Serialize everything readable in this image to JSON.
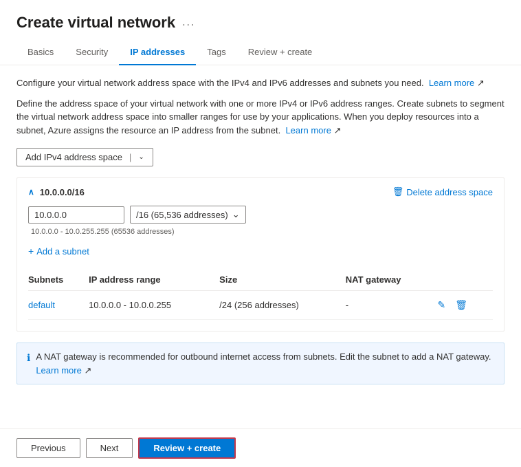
{
  "page": {
    "title": "Create virtual network",
    "more_label": "..."
  },
  "tabs": [
    {
      "id": "basics",
      "label": "Basics",
      "active": false
    },
    {
      "id": "security",
      "label": "Security",
      "active": false
    },
    {
      "id": "ip_addresses",
      "label": "IP addresses",
      "active": true
    },
    {
      "id": "tags",
      "label": "Tags",
      "active": false
    },
    {
      "id": "review_create",
      "label": "Review + create",
      "active": false
    }
  ],
  "descriptions": {
    "line1_text": "Configure your virtual network address space with the IPv4 and IPv6 addresses and subnets you need. ",
    "line1_link": "Learn more",
    "line2_text": "Define the address space of your virtual network with one or more IPv4 or IPv6 address ranges. Create subnets to segment the virtual network address space into smaller ranges for use by your applications. When you deploy resources into a subnet, Azure assigns the resource an IP address from the subnet. ",
    "line2_link": "Learn more"
  },
  "add_address_button": "Add IPv4 address space",
  "address_space": {
    "cidr": "10.0.0.0/16",
    "ip_value": "10.0.0.0",
    "cidr_dropdown": "/16 (65,536 addresses)",
    "hint": "10.0.0.0 - 10.0.255.255 (65536 addresses)",
    "delete_label": "Delete address space",
    "add_subnet_label": "Add a subnet"
  },
  "subnets_table": {
    "headers": [
      "Subnets",
      "IP address range",
      "Size",
      "NAT gateway"
    ],
    "rows": [
      {
        "name": "default",
        "ip_range": "10.0.0.0 - 10.0.0.255",
        "size": "/24 (256 addresses)",
        "nat_gateway": "-"
      }
    ]
  },
  "info_banner": {
    "text": "A NAT gateway is recommended for outbound internet access from subnets. Edit the subnet to add a NAT gateway. ",
    "link_label": "Learn more"
  },
  "footer": {
    "previous_label": "Previous",
    "next_label": "Next",
    "review_create_label": "Review + create"
  }
}
